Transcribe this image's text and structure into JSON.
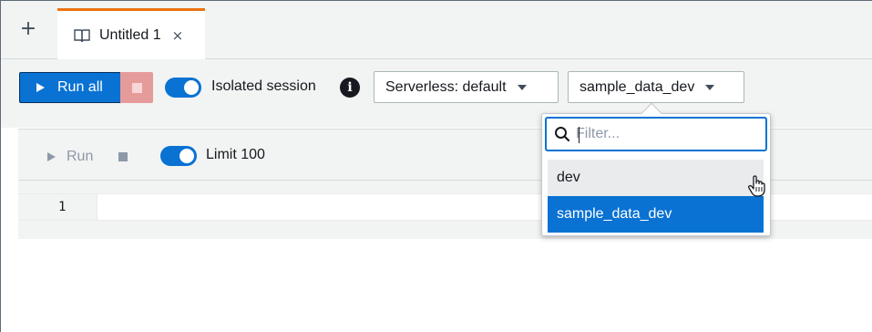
{
  "tabbar": {
    "add_symbol": "+",
    "tab": {
      "label": "Untitled 1",
      "close_symbol": "×"
    }
  },
  "toolbar": {
    "run_all_label": "Run all",
    "isolated_session_label": "Isolated session",
    "isolated_session_enabled": true,
    "info_symbol": "i",
    "workgroup_select": {
      "value": "Serverless: default"
    },
    "database_select": {
      "value": "sample_data_dev"
    }
  },
  "cell": {
    "run_label": "Run",
    "limit_label": "Limit 100",
    "limit_enabled": true,
    "line_number": "1"
  },
  "dropdown": {
    "filter_placeholder": "Filter...",
    "options": [
      {
        "label": "dev",
        "state": "hover"
      },
      {
        "label": "sample_data_dev",
        "state": "selected"
      }
    ]
  },
  "colors": {
    "primary": "#0972d3",
    "tab_accent": "#ec7211",
    "stop_button": "#e69b9b",
    "toolbar_bg": "#f2f3f3"
  },
  "icons": [
    "add-icon",
    "notebook-icon",
    "close-icon",
    "play-icon",
    "stop-icon",
    "info-icon",
    "caret-down-icon",
    "search-icon",
    "hand-pointer-icon"
  ]
}
